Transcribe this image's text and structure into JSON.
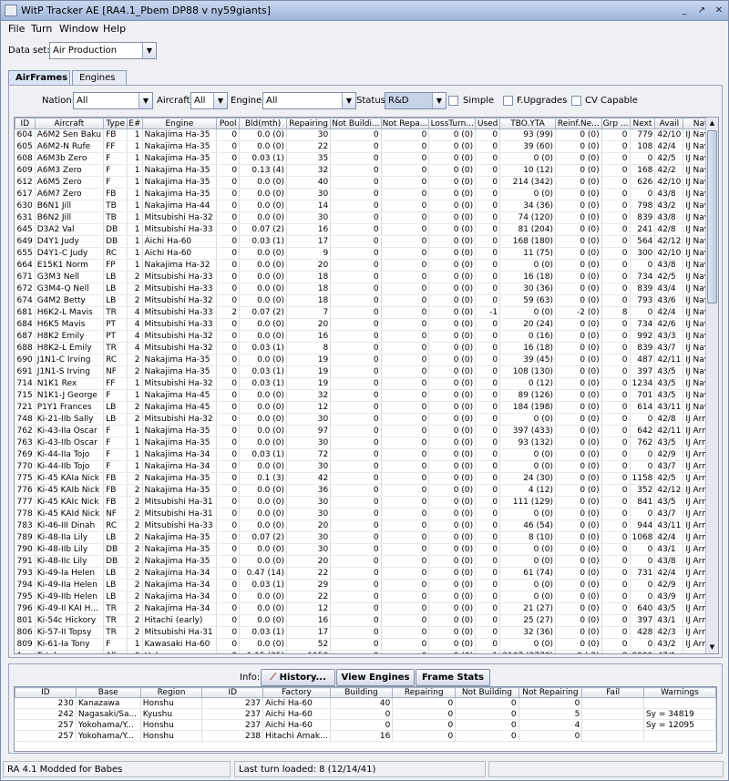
{
  "window": {
    "title": "WitP Tracker AE [RA4.1_Pbem DP88 v ny59giants]",
    "buttons": [
      "_",
      "↗",
      "✕"
    ]
  },
  "menu": [
    "File",
    "Turn",
    "Window",
    "Help"
  ],
  "dataset": {
    "label": "Data set:",
    "value": "Air Production"
  },
  "tabs": [
    "AirFrames",
    "Engines"
  ],
  "filters": {
    "nation_label": "Nation:",
    "nation": "All",
    "aircraft_label": "Aircraft:",
    "aircraft": "All",
    "engine_label": "Engine:",
    "engine": "All",
    "status_label": "Status:",
    "status": "R&D",
    "simple": "Simple",
    "fupgrades": "F.Upgrades",
    "cvcapable": "CV Capable"
  },
  "columns": [
    "ID",
    "Aircraft",
    "Type",
    "E#",
    "Engine",
    "Pool",
    "Bld(mth)",
    "Repairing",
    "Not Buildi...",
    "Not Repa...",
    "LossTurn...",
    "Used",
    "TBO.YTA",
    "Reinf.Ne...",
    "Grp ...",
    "Next",
    "Avail",
    "Nat"
  ],
  "rows": [
    [
      "604",
      "A6M2 Sen Baku",
      "FB",
      "1",
      "Nakajima Ha-35",
      "0",
      "0.0 (0)",
      "30",
      "0",
      "0",
      "0 (0)",
      "0",
      "93 (99)",
      "0 (0)",
      "0",
      "779",
      "42/10",
      "IJ Navy"
    ],
    [
      "605",
      "A6M2-N Rufe",
      "FF",
      "1",
      "Nakajima Ha-35",
      "0",
      "0.0 (0)",
      "22",
      "0",
      "0",
      "0 (0)",
      "0",
      "39 (60)",
      "0 (0)",
      "0",
      "108",
      "42/4",
      "IJ Navy"
    ],
    [
      "608",
      "A6M3b Zero",
      "F",
      "1",
      "Nakajima Ha-35",
      "0",
      "0.03 (1)",
      "35",
      "0",
      "0",
      "0 (0)",
      "0",
      "0 (0)",
      "0 (0)",
      "0",
      "0",
      "42/5",
      "IJ Navy"
    ],
    [
      "609",
      "A6M3 Zero",
      "F",
      "1",
      "Nakajima Ha-35",
      "0",
      "0.13 (4)",
      "32",
      "0",
      "0",
      "0 (0)",
      "0",
      "10 (12)",
      "0 (0)",
      "0",
      "168",
      "42/2",
      "IJ Navy"
    ],
    [
      "612",
      "A6M5 Zero",
      "F",
      "1",
      "Nakajima Ha-35",
      "0",
      "0.0 (0)",
      "40",
      "0",
      "0",
      "0 (0)",
      "0",
      "214 (342)",
      "0 (0)",
      "0",
      "626",
      "42/10",
      "IJ Navy"
    ],
    [
      "617",
      "A6M7 Zero",
      "FB",
      "1",
      "Nakajima Ha-35",
      "0",
      "0.0 (0)",
      "30",
      "0",
      "0",
      "0 (0)",
      "0",
      "0 (0)",
      "0 (0)",
      "0",
      "0",
      "43/8",
      "IJ Navy"
    ],
    [
      "630",
      "B6N1 Jill",
      "TB",
      "1",
      "Nakajima Ha-44",
      "0",
      "0.0 (0)",
      "14",
      "0",
      "0",
      "0 (0)",
      "0",
      "34 (36)",
      "0 (0)",
      "0",
      "798",
      "43/2",
      "IJ Navy"
    ],
    [
      "631",
      "B6N2 Jill",
      "TB",
      "1",
      "Mitsubishi Ha-32",
      "0",
      "0.0 (0)",
      "30",
      "0",
      "0",
      "0 (0)",
      "0",
      "74 (120)",
      "0 (0)",
      "0",
      "839",
      "43/8",
      "IJ Navy"
    ],
    [
      "645",
      "D3A2 Val",
      "DB",
      "1",
      "Mitsubishi Ha-33",
      "0",
      "0.07 (2)",
      "16",
      "0",
      "0",
      "0 (0)",
      "0",
      "81 (204)",
      "0 (0)",
      "0",
      "241",
      "42/8",
      "IJ Navy"
    ],
    [
      "649",
      "D4Y1 Judy",
      "DB",
      "1",
      "Aichi Ha-60",
      "0",
      "0.03 (1)",
      "17",
      "0",
      "0",
      "0 (0)",
      "0",
      "168 (180)",
      "0 (0)",
      "0",
      "564",
      "42/12",
      "IJ Navy"
    ],
    [
      "655",
      "D4Y1-C Judy",
      "RC",
      "1",
      "Aichi Ha-60",
      "0",
      "0.0 (0)",
      "9",
      "0",
      "0",
      "0 (0)",
      "0",
      "11 (75)",
      "0 (0)",
      "0",
      "300",
      "42/10",
      "IJ Navy"
    ],
    [
      "664",
      "E15K1 Norm",
      "FP",
      "1",
      "Nakajima Ha-32",
      "0",
      "0.0 (0)",
      "20",
      "0",
      "0",
      "0 (0)",
      "0",
      "0 (0)",
      "0 (0)",
      "0",
      "0",
      "43/8",
      "IJ Navy"
    ],
    [
      "671",
      "G3M3 Nell",
      "LB",
      "2",
      "Mitsubishi Ha-33",
      "0",
      "0.0 (0)",
      "18",
      "0",
      "0",
      "0 (0)",
      "0",
      "16 (18)",
      "0 (0)",
      "0",
      "734",
      "42/5",
      "IJ Navy"
    ],
    [
      "672",
      "G3M4-Q Nell",
      "LB",
      "2",
      "Mitsubishi Ha-33",
      "0",
      "0.0 (0)",
      "18",
      "0",
      "0",
      "0 (0)",
      "0",
      "30 (36)",
      "0 (0)",
      "0",
      "839",
      "43/4",
      "IJ Navy"
    ],
    [
      "674",
      "G4M2 Betty",
      "LB",
      "2",
      "Mitsubishi Ha-32",
      "0",
      "0.0 (0)",
      "18",
      "0",
      "0",
      "0 (0)",
      "0",
      "59 (63)",
      "0 (0)",
      "0",
      "793",
      "43/6",
      "IJ Navy"
    ],
    [
      "681",
      "H6K2-L Mavis",
      "TR",
      "4",
      "Mitsubishi Ha-33",
      "2",
      "0.07 (2)",
      "7",
      "0",
      "0",
      "0 (0)",
      "-1",
      "0 (0)",
      "-2 (0)",
      "8",
      "0",
      "42/4",
      "IJ Navy"
    ],
    [
      "684",
      "H6K5 Mavis",
      "PT",
      "4",
      "Mitsubishi Ha-33",
      "0",
      "0.0 (0)",
      "20",
      "0",
      "0",
      "0 (0)",
      "0",
      "20 (24)",
      "0 (0)",
      "0",
      "734",
      "42/6",
      "IJ Navy"
    ],
    [
      "687",
      "H8K2 Emily",
      "PT",
      "4",
      "Mitsubishi Ha-32",
      "0",
      "0.0 (0)",
      "16",
      "0",
      "0",
      "0 (0)",
      "0",
      "0 (16)",
      "0 (0)",
      "0",
      "992",
      "43/3",
      "IJ Navy"
    ],
    [
      "688",
      "H8K2-L Emily",
      "TR",
      "4",
      "Mitsubishi Ha-32",
      "0",
      "0.03 (1)",
      "8",
      "0",
      "0",
      "0 (0)",
      "0",
      "16 (18)",
      "0 (0)",
      "0",
      "839",
      "43/7",
      "IJ Navy"
    ],
    [
      "690",
      "J1N1-C Irving",
      "RC",
      "2",
      "Nakajima Ha-35",
      "0",
      "0.0 (0)",
      "19",
      "0",
      "0",
      "0 (0)",
      "0",
      "39 (45)",
      "0 (0)",
      "0",
      "487",
      "42/11",
      "IJ Navy"
    ],
    [
      "691",
      "J1N1-S Irving",
      "NF",
      "2",
      "Nakajima Ha-35",
      "0",
      "0.03 (1)",
      "19",
      "0",
      "0",
      "0 (0)",
      "0",
      "108 (130)",
      "0 (0)",
      "0",
      "397",
      "43/5",
      "IJ Navy"
    ],
    [
      "714",
      "N1K1 Rex",
      "FF",
      "1",
      "Mitsubishi Ha-32",
      "0",
      "0.03 (1)",
      "19",
      "0",
      "0",
      "0 (0)",
      "0",
      "0 (12)",
      "0 (0)",
      "0",
      "1234",
      "43/5",
      "IJ Navy"
    ],
    [
      "715",
      "N1K1-J George",
      "F",
      "1",
      "Nakajima Ha-45",
      "0",
      "0.0 (0)",
      "32",
      "0",
      "0",
      "0 (0)",
      "0",
      "89 (126)",
      "0 (0)",
      "0",
      "701",
      "43/5",
      "IJ Navy"
    ],
    [
      "721",
      "P1Y1 Frances",
      "LB",
      "2",
      "Nakajima Ha-45",
      "0",
      "0.0 (0)",
      "12",
      "0",
      "0",
      "0 (0)",
      "0",
      "184 (198)",
      "0 (0)",
      "0",
      "614",
      "43/11",
      "IJ Navy"
    ],
    [
      "748",
      "Ki-21-IIb Sally",
      "LB",
      "2",
      "Mitsubishi Ha-32",
      "0",
      "0.0 (0)",
      "30",
      "0",
      "0",
      "0 (0)",
      "0",
      "0 (0)",
      "0 (0)",
      "0",
      "0",
      "42/8",
      "IJ Army"
    ],
    [
      "762",
      "Ki-43-IIa Oscar",
      "F",
      "1",
      "Nakajima Ha-35",
      "0",
      "0.0 (0)",
      "97",
      "0",
      "0",
      "0 (0)",
      "0",
      "397 (433)",
      "0 (0)",
      "0",
      "642",
      "42/11",
      "IJ Army"
    ],
    [
      "763",
      "Ki-43-IIb Oscar",
      "F",
      "1",
      "Nakajima Ha-35",
      "0",
      "0.0 (0)",
      "30",
      "0",
      "0",
      "0 (0)",
      "0",
      "93 (132)",
      "0 (0)",
      "0",
      "762",
      "43/5",
      "IJ Army"
    ],
    [
      "769",
      "Ki-44-IIa Tojo",
      "F",
      "1",
      "Nakajima Ha-34",
      "0",
      "0.03 (1)",
      "72",
      "0",
      "0",
      "0 (0)",
      "0",
      "0 (0)",
      "0 (0)",
      "0",
      "0",
      "42/9",
      "IJ Army"
    ],
    [
      "770",
      "Ki-44-IIb Tojo",
      "F",
      "1",
      "Nakajima Ha-34",
      "0",
      "0.0 (0)",
      "30",
      "0",
      "0",
      "0 (0)",
      "0",
      "0 (0)",
      "0 (0)",
      "0",
      "0",
      "43/7",
      "IJ Army"
    ],
    [
      "775",
      "Ki-45 KAIa Nick",
      "FB",
      "2",
      "Nakajima Ha-35",
      "0",
      "0.1 (3)",
      "42",
      "0",
      "0",
      "0 (0)",
      "0",
      "24 (30)",
      "0 (0)",
      "0",
      "1158",
      "42/5",
      "IJ Army"
    ],
    [
      "776",
      "Ki-45 KAIb Nick",
      "FB",
      "2",
      "Nakajima Ha-35",
      "0",
      "0.0 (0)",
      "36",
      "0",
      "0",
      "0 (0)",
      "0",
      "4 (12)",
      "0 (0)",
      "0",
      "352",
      "42/12",
      "IJ Army"
    ],
    [
      "777",
      "Ki-45 KAIc Nick",
      "FB",
      "2",
      "Mitsubishi Ha-31",
      "0",
      "0.0 (0)",
      "30",
      "0",
      "0",
      "0 (0)",
      "0",
      "111 (129)",
      "0 (0)",
      "0",
      "841",
      "43/5",
      "IJ Army"
    ],
    [
      "778",
      "Ki-45 KAId Nick",
      "NF",
      "2",
      "Mitsubishi Ha-31",
      "0",
      "0.0 (0)",
      "30",
      "0",
      "0",
      "0 (0)",
      "0",
      "0 (0)",
      "0 (0)",
      "0",
      "0",
      "43/7",
      "IJ Army"
    ],
    [
      "783",
      "Ki-46-III Dinah",
      "RC",
      "2",
      "Mitsubishi Ha-33",
      "0",
      "0.0 (0)",
      "20",
      "0",
      "0",
      "0 (0)",
      "0",
      "46 (54)",
      "0 (0)",
      "0",
      "944",
      "43/11",
      "IJ Army"
    ],
    [
      "789",
      "Ki-48-IIa Lily",
      "LB",
      "2",
      "Nakajima Ha-35",
      "0",
      "0.07 (2)",
      "30",
      "0",
      "0",
      "0 (0)",
      "0",
      "8 (10)",
      "0 (0)",
      "0",
      "1068",
      "42/4",
      "IJ Army"
    ],
    [
      "790",
      "Ki-48-IIb Lily",
      "DB",
      "2",
      "Nakajima Ha-35",
      "0",
      "0.0 (0)",
      "30",
      "0",
      "0",
      "0 (0)",
      "0",
      "0 (0)",
      "0 (0)",
      "0",
      "0",
      "43/1",
      "IJ Army"
    ],
    [
      "791",
      "Ki-48-IIc Lily",
      "DB",
      "2",
      "Nakajima Ha-35",
      "0",
      "0.0 (0)",
      "20",
      "0",
      "0",
      "0 (0)",
      "0",
      "0 (0)",
      "0 (0)",
      "0",
      "0",
      "43/8",
      "IJ Army"
    ],
    [
      "793",
      "Ki-49-Ia Helen",
      "LB",
      "2",
      "Nakajima Ha-34",
      "0",
      "0.47 (14)",
      "22",
      "0",
      "0",
      "0 (0)",
      "0",
      "61 (74)",
      "0 (0)",
      "0",
      "731",
      "42/4",
      "IJ Army"
    ],
    [
      "794",
      "Ki-49-IIa Helen",
      "LB",
      "2",
      "Nakajima Ha-34",
      "0",
      "0.03 (1)",
      "29",
      "0",
      "0",
      "0 (0)",
      "0",
      "0 (0)",
      "0 (0)",
      "0",
      "0",
      "42/9",
      "IJ Army"
    ],
    [
      "795",
      "Ki-49-IIb Helen",
      "LB",
      "2",
      "Nakajima Ha-34",
      "0",
      "0.0 (0)",
      "22",
      "0",
      "0",
      "0 (0)",
      "0",
      "0 (0)",
      "0 (0)",
      "0",
      "0",
      "43/9",
      "IJ Army"
    ],
    [
      "796",
      "Ki-49-II KAI H...",
      "TR",
      "2",
      "Nakajima Ha-34",
      "0",
      "0.0 (0)",
      "12",
      "0",
      "0",
      "0 (0)",
      "0",
      "21 (27)",
      "0 (0)",
      "0",
      "640",
      "43/5",
      "IJ Army"
    ],
    [
      "801",
      "Ki-54c Hickory",
      "TR",
      "2",
      "Hitachi (early)",
      "0",
      "0.0 (0)",
      "16",
      "0",
      "0",
      "0 (0)",
      "0",
      "25 (27)",
      "0 (0)",
      "0",
      "397",
      "43/1",
      "IJ Army"
    ],
    [
      "806",
      "Ki-57-II Topsy",
      "TR",
      "2",
      "Mitsubishi Ha-31",
      "0",
      "0.03 (1)",
      "17",
      "0",
      "0",
      "0 (0)",
      "0",
      "32 (36)",
      "0 (0)",
      "0",
      "428",
      "42/3",
      "IJ Army"
    ],
    [
      "809",
      "Ki-61-Ia Tony",
      "F",
      "1",
      "Kawasaki Ha-60",
      "0",
      "0.0 (0)",
      "52",
      "0",
      "0",
      "0 (0)",
      "0",
      "0 (0)",
      "0 (0)",
      "0",
      "0",
      "43/2",
      "IJ Army"
    ],
    [
      "1",
      "Totals",
      "All",
      "0",
      "Unknown",
      "2",
      "1.15 (35)",
      "1153",
      "0",
      "0",
      "0 (0)",
      "-1",
      "2107 (2778)",
      "0 (-2)",
      "8",
      "9999",
      "47/1",
      "none"
    ]
  ],
  "info": {
    "label": "Info:",
    "history": "History...",
    "view_engines": "View Engines",
    "frame_stats": "Frame Stats"
  },
  "bottom_columns": [
    "ID",
    "Base",
    "Region",
    "ID",
    "Factory",
    "Building",
    "Repairing",
    "Not Building",
    "Not Repairing",
    "Fail",
    "Warnings"
  ],
  "bottom_rows": [
    [
      "230",
      "Kanazawa",
      "Honshu",
      "237",
      "Aichi Ha-60",
      "40",
      "0",
      "0",
      "0",
      "",
      ""
    ],
    [
      "242",
      "Nagasaki/Sa...",
      "Kyushu",
      "237",
      "Aichi Ha-60",
      "0",
      "0",
      "0",
      "5",
      "",
      "Sy = 34819"
    ],
    [
      "257",
      "Yokohama/Y...",
      "Honshu",
      "237",
      "Aichi Ha-60",
      "0",
      "0",
      "0",
      "4",
      "",
      "Sy = 12095"
    ],
    [
      "257",
      "Yokohama/Y...",
      "Honshu",
      "238",
      "Hitachi Amak...",
      "16",
      "0",
      "0",
      "0",
      "",
      ""
    ]
  ],
  "status": {
    "left": "RA 4.1 Modded for Babes",
    "middle": "Last turn loaded: 8 (12/14/41)",
    "right": ""
  }
}
